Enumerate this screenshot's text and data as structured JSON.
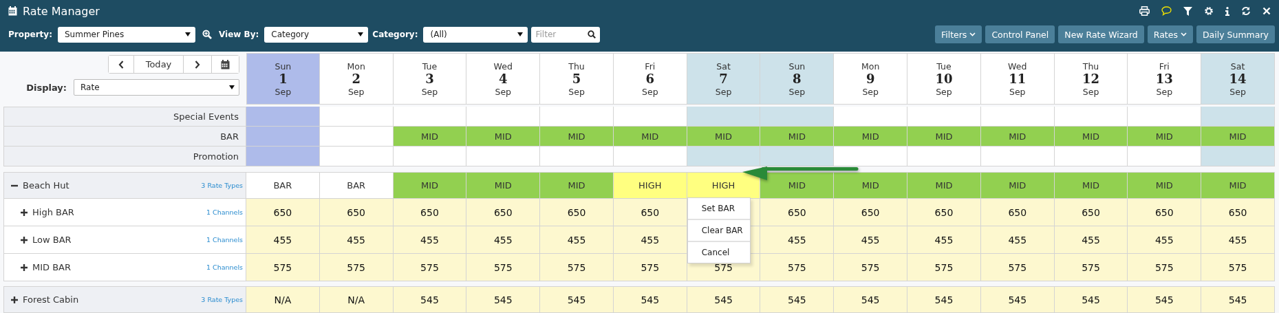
{
  "window": {
    "title": "Rate Manager"
  },
  "filters": {
    "property": {
      "label": "Property:",
      "value": "Summer Pines"
    },
    "view_by": {
      "label": "View By:",
      "value": "Category"
    },
    "category": {
      "label": "Category:",
      "value": "(All)"
    },
    "search": {
      "placeholder": "Filter"
    }
  },
  "buttons": [
    {
      "label": "Filters",
      "dropdown": true
    },
    {
      "label": "Control Panel",
      "dropdown": false
    },
    {
      "label": "New Rate Wizard",
      "dropdown": false
    },
    {
      "label": "Rates",
      "dropdown": true
    },
    {
      "label": "Daily Summary",
      "dropdown": false
    }
  ],
  "navigation": {
    "today": "Today"
  },
  "display": {
    "label": "Display:",
    "value": "Rate"
  },
  "days": [
    {
      "weekday": "Sun",
      "day": "1",
      "month": "Sep",
      "selected": true
    },
    {
      "weekday": "Mon",
      "day": "2",
      "month": "Sep",
      "selected": false,
      "weekend": false
    },
    {
      "weekday": "Tue",
      "day": "3",
      "month": "Sep",
      "selected": false,
      "weekend": false
    },
    {
      "weekday": "Wed",
      "day": "4",
      "month": "Sep",
      "selected": false,
      "weekend": false
    },
    {
      "weekday": "Thu",
      "day": "5",
      "month": "Sep",
      "selected": false,
      "weekend": false
    },
    {
      "weekday": "Fri",
      "day": "6",
      "month": "Sep",
      "selected": false,
      "weekend": false
    },
    {
      "weekday": "Sat",
      "day": "7",
      "month": "Sep",
      "selected": false,
      "weekend": true
    },
    {
      "weekday": "Sun",
      "day": "8",
      "month": "Sep",
      "selected": false,
      "weekend": true
    },
    {
      "weekday": "Mon",
      "day": "9",
      "month": "Sep",
      "selected": false,
      "weekend": false
    },
    {
      "weekday": "Tue",
      "day": "10",
      "month": "Sep",
      "selected": false,
      "weekend": false
    },
    {
      "weekday": "Wed",
      "day": "11",
      "month": "Sep",
      "selected": false,
      "weekend": false
    },
    {
      "weekday": "Thu",
      "day": "12",
      "month": "Sep",
      "selected": false,
      "weekend": false
    },
    {
      "weekday": "Fri",
      "day": "13",
      "month": "Sep",
      "selected": false,
      "weekend": false
    },
    {
      "weekday": "Sat",
      "day": "14",
      "month": "Sep",
      "selected": false,
      "weekend": true
    }
  ],
  "summary_rows": [
    {
      "label": "Special Events",
      "cells": [
        null,
        null,
        null,
        null,
        null,
        null,
        null,
        null,
        null,
        null,
        null,
        null,
        null,
        null
      ]
    },
    {
      "label": "BAR",
      "cells": [
        null,
        null,
        "MID",
        "MID",
        "MID",
        "MID",
        "MID",
        "MID",
        "MID",
        "MID",
        "MID",
        "MID",
        "MID",
        "MID"
      ]
    },
    {
      "label": "Promotion",
      "cells": [
        null,
        null,
        null,
        null,
        null,
        null,
        null,
        null,
        null,
        null,
        null,
        null,
        null,
        null
      ]
    }
  ],
  "groups": [
    {
      "name": "Beach Hut",
      "count": "3 Rate Types",
      "expanded": true,
      "cells": [
        {
          "text": "BAR",
          "kind": "bar"
        },
        {
          "text": "BAR",
          "kind": "bar"
        },
        {
          "text": "MID",
          "kind": "mid"
        },
        {
          "text": "MID",
          "kind": "mid"
        },
        {
          "text": "MID",
          "kind": "mid"
        },
        {
          "text": "HIGH",
          "kind": "high"
        },
        {
          "text": "HIGH",
          "kind": "high",
          "context_menu": [
            "Set BAR",
            "Clear BAR",
            "Cancel"
          ]
        },
        {
          "text": "MID",
          "kind": "mid"
        },
        {
          "text": "MID",
          "kind": "mid"
        },
        {
          "text": "MID",
          "kind": "mid"
        },
        {
          "text": "MID",
          "kind": "mid"
        },
        {
          "text": "MID",
          "kind": "mid"
        },
        {
          "text": "MID",
          "kind": "mid"
        },
        {
          "text": "MID",
          "kind": "mid"
        }
      ],
      "children": [
        {
          "name": "High BAR",
          "count": "1 Channels",
          "expanded": false,
          "cells": [
            {
              "text": "650",
              "kind": "rate"
            },
            {
              "text": "650",
              "kind": "rate"
            },
            {
              "text": "650",
              "kind": "rate"
            },
            {
              "text": "650",
              "kind": "rate"
            },
            {
              "text": "650",
              "kind": "rate"
            },
            {
              "text": "650",
              "kind": "rate"
            },
            {
              "kind": "rate"
            },
            {
              "text": "650",
              "kind": "rate"
            },
            {
              "text": "650",
              "kind": "rate"
            },
            {
              "text": "650",
              "kind": "rate"
            },
            {
              "text": "650",
              "kind": "rate"
            },
            {
              "text": "650",
              "kind": "rate"
            },
            {
              "text": "650",
              "kind": "rate"
            },
            {
              "text": "650",
              "kind": "rate"
            }
          ]
        },
        {
          "name": "Low BAR",
          "count": "1 Channels",
          "expanded": false,
          "cells": [
            {
              "text": "455",
              "kind": "rate"
            },
            {
              "text": "455",
              "kind": "rate"
            },
            {
              "text": "455",
              "kind": "rate"
            },
            {
              "text": "455",
              "kind": "rate"
            },
            {
              "text": "455",
              "kind": "rate"
            },
            {
              "text": "455",
              "kind": "rate"
            },
            {
              "kind": "rate"
            },
            {
              "text": "455",
              "kind": "rate"
            },
            {
              "text": "455",
              "kind": "rate"
            },
            {
              "text": "455",
              "kind": "rate"
            },
            {
              "text": "455",
              "kind": "rate"
            },
            {
              "text": "455",
              "kind": "rate"
            },
            {
              "text": "455",
              "kind": "rate"
            },
            {
              "text": "455",
              "kind": "rate"
            }
          ]
        },
        {
          "name": "MID BAR",
          "count": "1 Channels",
          "expanded": false,
          "cells": [
            {
              "text": "575",
              "kind": "rate"
            },
            {
              "text": "575",
              "kind": "rate"
            },
            {
              "text": "575",
              "kind": "rate"
            },
            {
              "text": "575",
              "kind": "rate"
            },
            {
              "text": "575",
              "kind": "rate"
            },
            {
              "text": "575",
              "kind": "rate"
            },
            {
              "text": "575",
              "kind": "rate"
            },
            {
              "text": "575",
              "kind": "rate"
            },
            {
              "text": "575",
              "kind": "rate"
            },
            {
              "text": "575",
              "kind": "rate"
            },
            {
              "text": "575",
              "kind": "rate"
            },
            {
              "text": "575",
              "kind": "rate"
            },
            {
              "text": "575",
              "kind": "rate"
            },
            {
              "text": "575",
              "kind": "rate"
            }
          ]
        }
      ]
    },
    {
      "name": "Forest Cabin",
      "count": "3 Rate Types",
      "expanded": false,
      "cells": [
        {
          "text": "N/A",
          "kind": "rate"
        },
        {
          "text": "N/A",
          "kind": "rate"
        },
        {
          "text": "545",
          "kind": "rate"
        },
        {
          "text": "545",
          "kind": "rate"
        },
        {
          "text": "545",
          "kind": "rate"
        },
        {
          "text": "545",
          "kind": "rate"
        },
        {
          "text": "545",
          "kind": "rate"
        },
        {
          "text": "545",
          "kind": "rate"
        },
        {
          "text": "545",
          "kind": "rate"
        },
        {
          "text": "545",
          "kind": "rate"
        },
        {
          "text": "545",
          "kind": "rate"
        },
        {
          "text": "545",
          "kind": "rate"
        },
        {
          "text": "545",
          "kind": "rate"
        },
        {
          "text": "545",
          "kind": "rate"
        }
      ]
    }
  ]
}
